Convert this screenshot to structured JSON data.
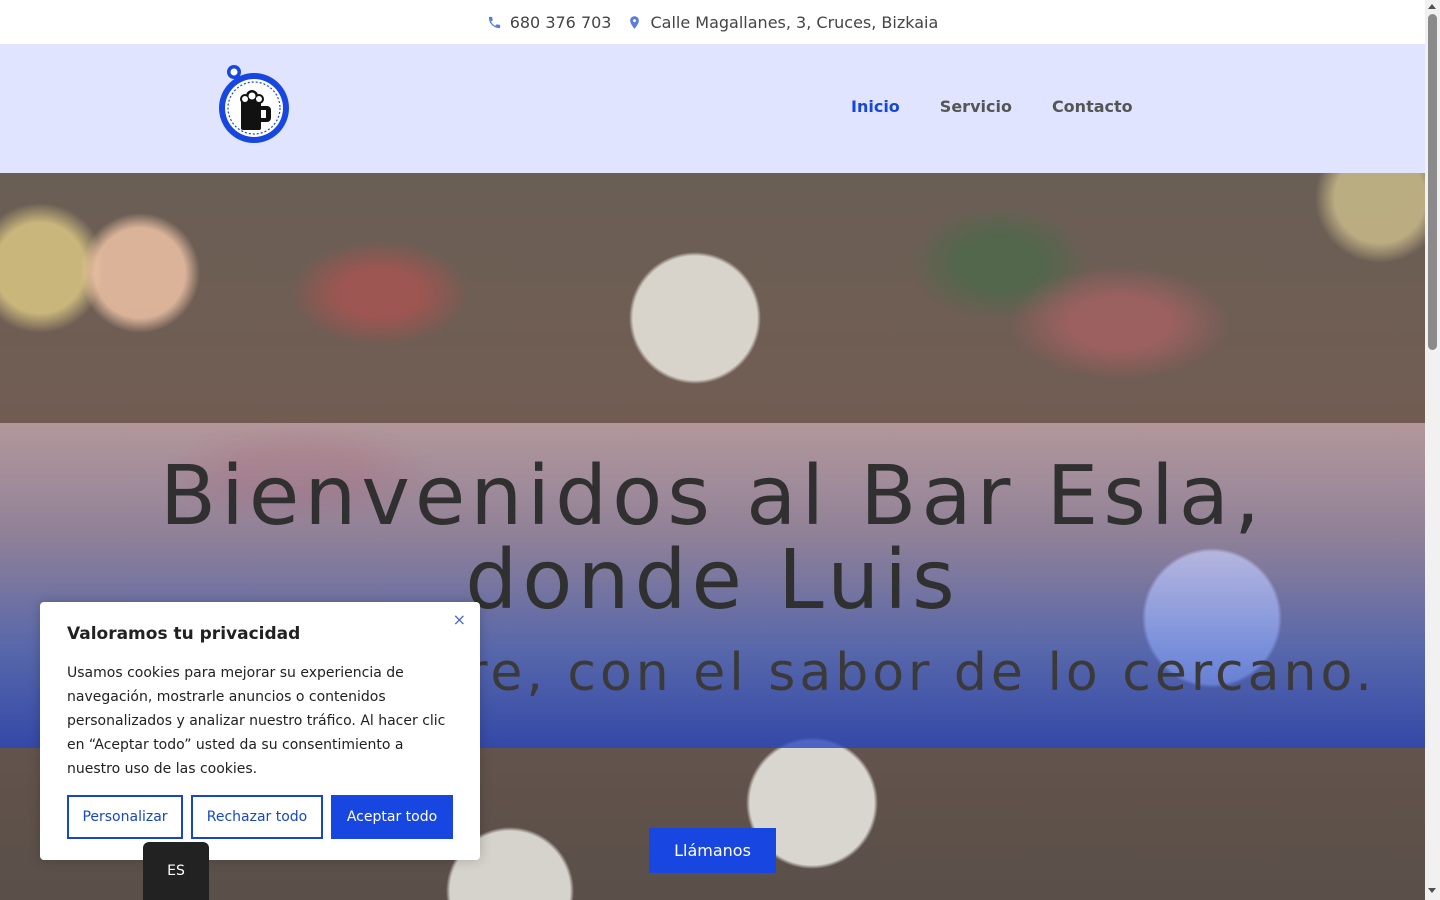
{
  "topbar": {
    "phone": "680 376 703",
    "address": "Calle Magallanes, 3, Cruces, Bizkaia"
  },
  "nav": {
    "items": [
      {
        "label": "Inicio",
        "active": true
      },
      {
        "label": "Servicio",
        "active": false
      },
      {
        "label": "Contacto",
        "active": false
      }
    ]
  },
  "hero": {
    "title": "Bienvenidos al Bar Esla, donde Luis",
    "subtitle_visible": "pre, con el sabor de lo cercano.",
    "cta_label": "Llámanos"
  },
  "cookie_banner": {
    "title": "Valoramos tu privacidad",
    "body": "Usamos cookies para mejorar su experiencia de navegación, mostrarle anuncios o contenidos personalizados y analizar nuestro tráfico. Al hacer clic en “Aceptar todo” usted da su consentimiento a nuestro uso de las cookies.",
    "close_label": "×",
    "buttons": {
      "customize": "Personalizar",
      "reject": "Rechazar todo",
      "accept": "Aceptar todo"
    }
  },
  "language": {
    "current": "ES"
  },
  "colors": {
    "accent": "#1747e0",
    "header_bg": "#e0e4fe"
  }
}
